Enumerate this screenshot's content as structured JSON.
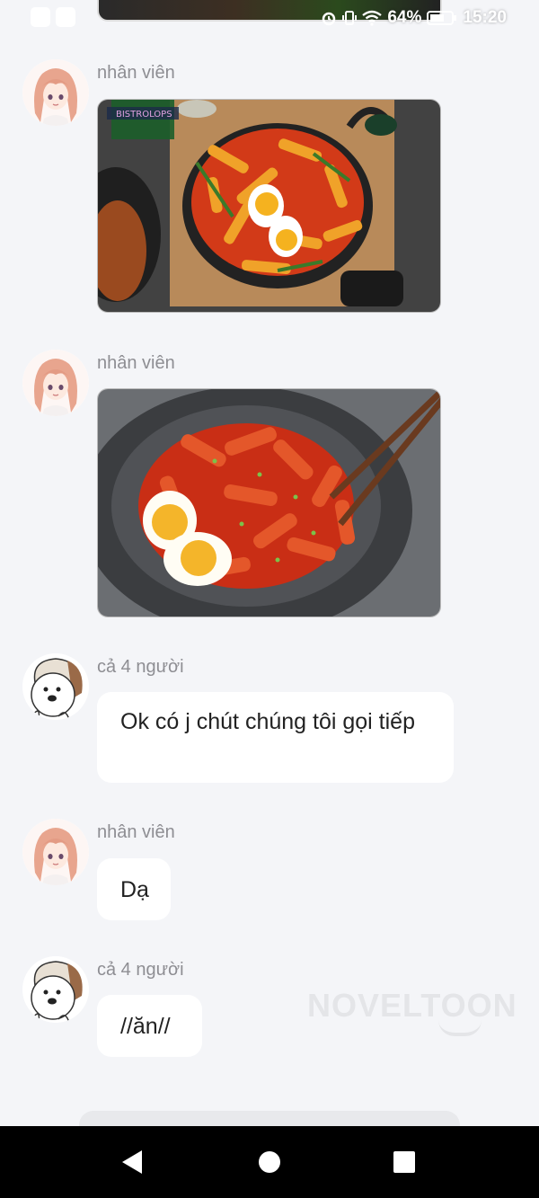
{
  "status_bar": {
    "battery": "64%",
    "time": "15:20"
  },
  "messages": [
    {
      "sender": "nhân viên",
      "type": "image",
      "image_desc": "tteokbokki-pan"
    },
    {
      "sender": "nhân viên",
      "type": "image",
      "image_desc": "tteokbokki-bowl"
    },
    {
      "sender": "cả 4 người",
      "type": "text",
      "text": "Ok có j chút chúng tôi gọi tiếp"
    },
    {
      "sender": "nhân viên",
      "type": "text",
      "text": "Dạ"
    },
    {
      "sender": "cả 4 người",
      "type": "text",
      "text": "//ăn//"
    }
  ],
  "photo_overlay_text": "BISTROLOPS",
  "watermark": "NOVELTOON",
  "nav": {
    "back": "back-icon",
    "home": "home-icon",
    "recents": "recents-icon"
  },
  "colors": {
    "background": "#f4f5f8",
    "bubble": "#ffffff",
    "sender_name": "#8e8e93",
    "nav_bar": "#000000"
  }
}
